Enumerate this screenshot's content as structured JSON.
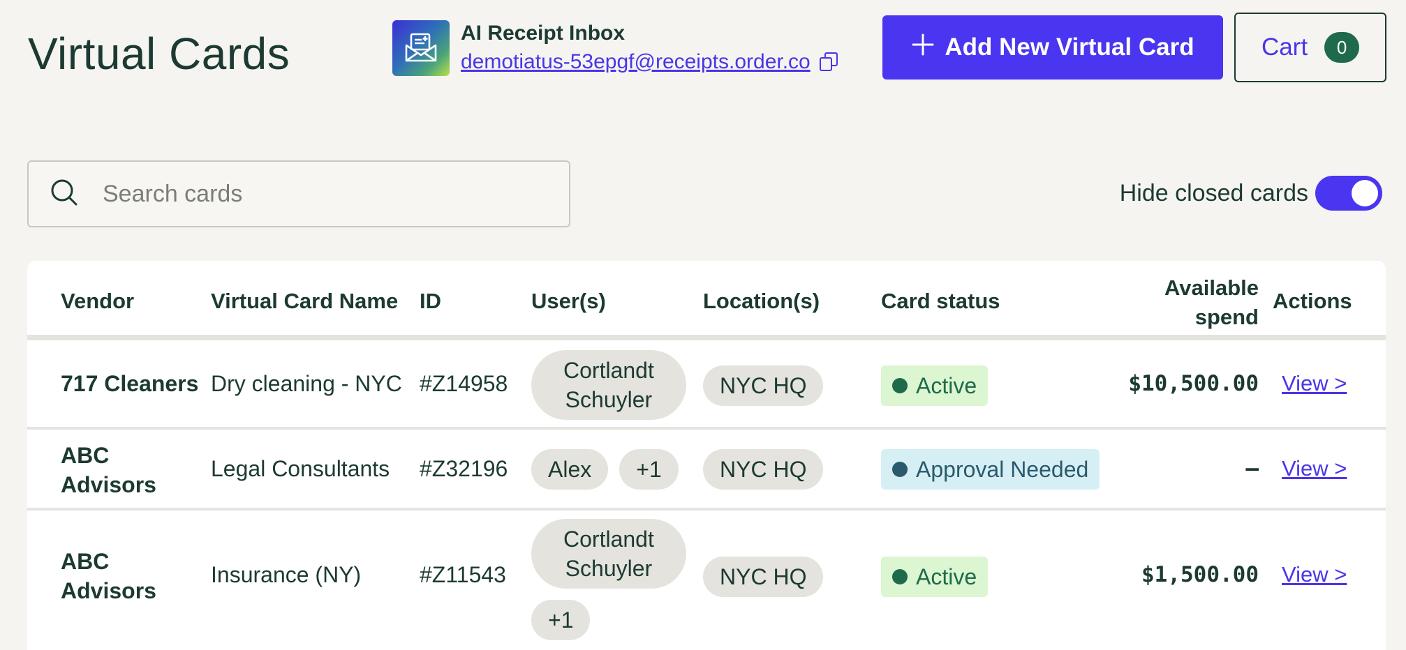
{
  "header": {
    "title": "Virtual Cards",
    "inbox_title": "AI Receipt Inbox",
    "inbox_email": "demotiatus-53epgf@receipts.order.co",
    "add_button_label": "Add New Virtual Card",
    "cart_label": "Cart",
    "cart_count": "0"
  },
  "search": {
    "placeholder": "Search cards"
  },
  "toggle": {
    "label": "Hide closed cards",
    "on": true
  },
  "colors": {
    "accent": "#4a35f0",
    "text": "#1c3a32",
    "active_bg": "#dbf6d0",
    "approval_bg": "#d6eff5"
  },
  "table": {
    "columns": {
      "vendor": "Vendor",
      "card_name": "Virtual Card Name",
      "id": "ID",
      "users": "User(s)",
      "locations": "Location(s)",
      "status": "Card status",
      "spend_line1": "Available",
      "spend_line2": "spend",
      "actions": "Actions"
    },
    "rows": [
      {
        "vendor": "717 Cleaners",
        "card_name": "Dry cleaning - NYC",
        "id": "#Z14958",
        "user_line1": "Cortlandt",
        "user_line2": "Schuyler",
        "location": "NYC HQ",
        "status": "Active",
        "spend": "$10,500.00",
        "action": "View >"
      },
      {
        "vendor_line1": "ABC",
        "vendor_line2": "Advisors",
        "card_name": "Legal Consultants",
        "id": "#Z32196",
        "user": "Alex",
        "user_more": "+1",
        "location": "NYC HQ",
        "status": "Approval Needed",
        "spend": "–",
        "action": "View >"
      },
      {
        "vendor_line1": "ABC",
        "vendor_line2": "Advisors",
        "card_name": "Insurance (NY)",
        "id": "#Z11543",
        "user_line1": "Cortlandt",
        "user_line2": "Schuyler",
        "user_more": "+1",
        "location": "NYC HQ",
        "status": "Active",
        "spend": "$1,500.00",
        "action": "View >"
      }
    ]
  }
}
